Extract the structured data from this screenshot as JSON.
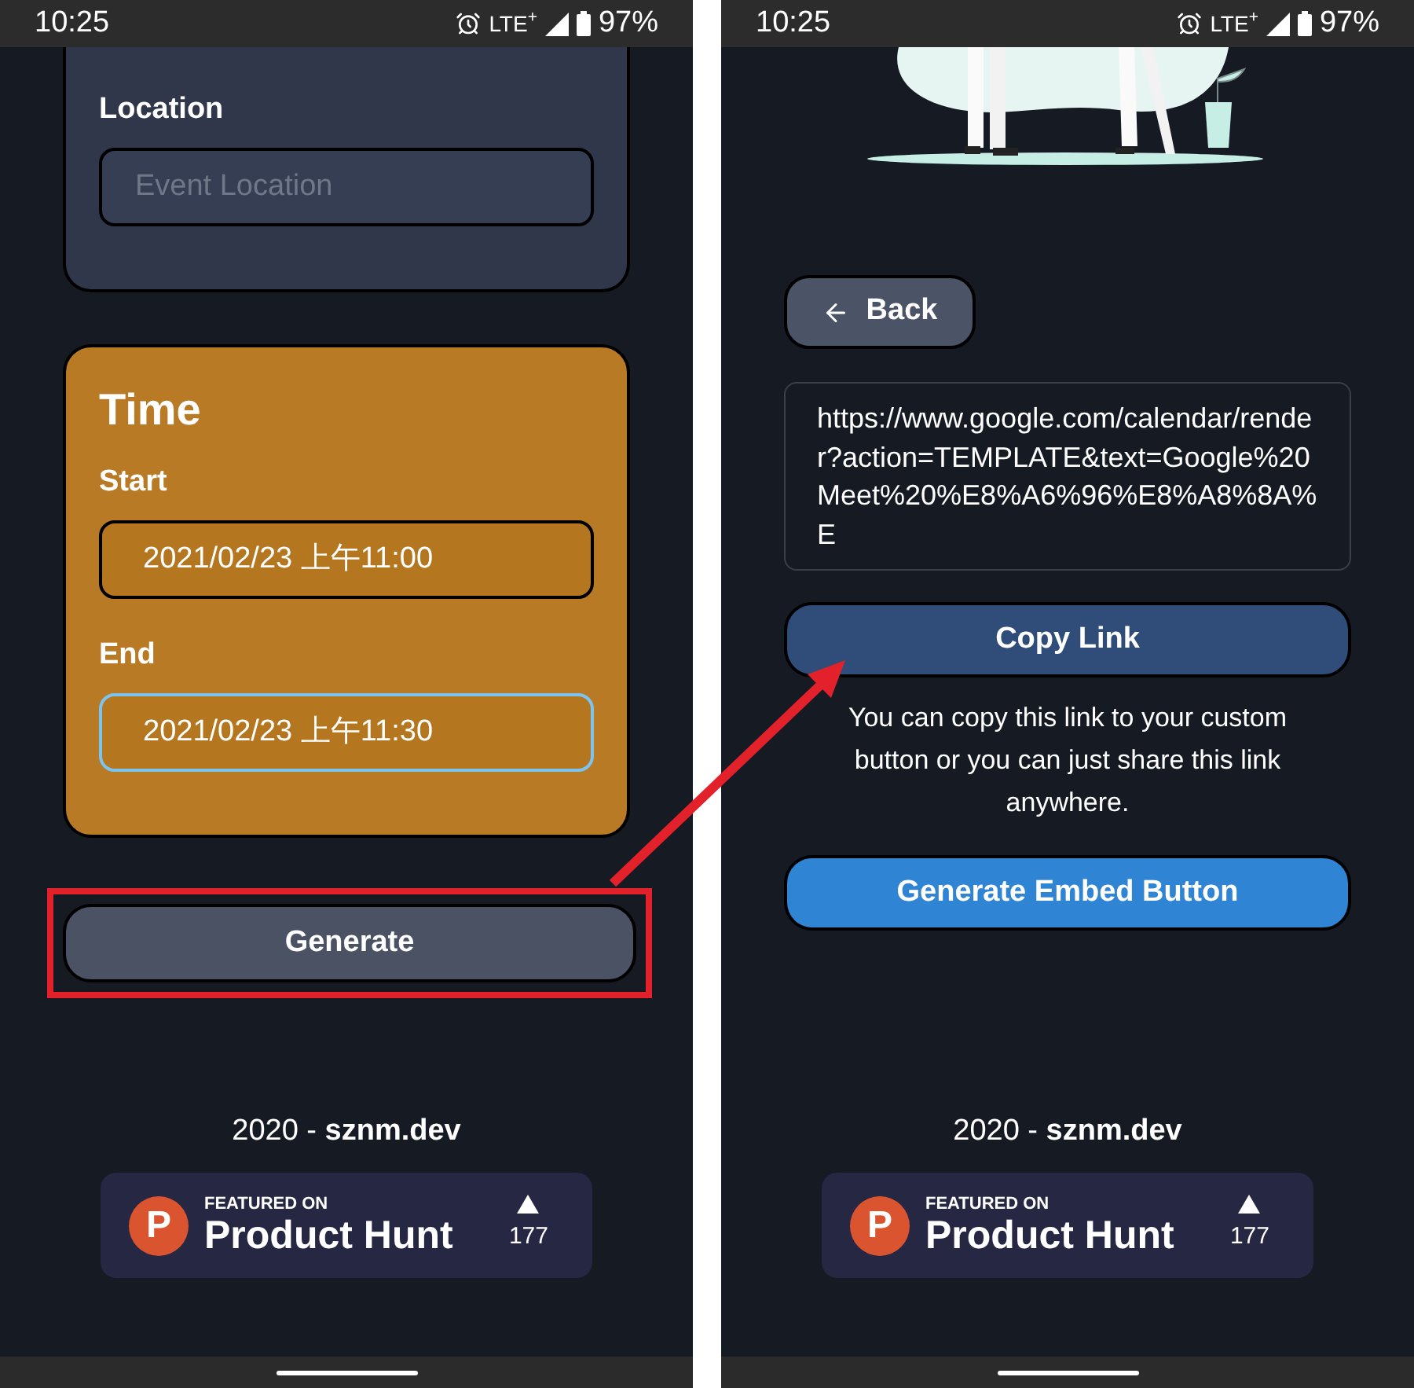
{
  "screens": [
    {
      "status_bar": {
        "time": "10:25",
        "network": "LTE$^{+}$",
        "battery": "97%"
      },
      "location_card": {
        "label": "Location",
        "placeholder": "Event Location"
      },
      "time_card": {
        "title": "Time",
        "fields": [
          {
            "label": "Start",
            "value": "2021/02/23 上午11:00",
            "focused": false
          },
          {
            "label": "End",
            "value": "2021/02/23 上午11:30",
            "focused": true
          }
        ]
      },
      "generate_button": {
        "label": "Generate",
        "highlighted": true
      },
      "footer": {
        "credit": "2020 - **sznm.dev**",
        "badge": {
          "logo_letter": "P",
          "eyebrow": "FEATURED ON",
          "name": "Product Hunt",
          "upvotes": "177"
        }
      }
    },
    {
      "status_bar": {
        "time": "10:25",
        "network": "LTE$^{+}$",
        "battery": "97%"
      },
      "back_button": {
        "label": "Back"
      },
      "link_box": {
        "value": "https://www.google.com/calendar/render?action=TEMPLATE&text=Google%20Meet%20%E8%A6%96%E8%A8%8A%E"
      },
      "copy_button": {
        "label": "Copy Link"
      },
      "note": "You can copy this link to your custom button or you can just share this link anywhere.",
      "embed_button": {
        "label": "Generate Embed Button"
      },
      "footer": {
        "credit": "2020 - **sznm.dev**",
        "badge": {
          "logo_letter": "P",
          "eyebrow": "FEATURED ON",
          "name": "Product Hunt",
          "upvotes": "177"
        }
      }
    }
  ]
}
